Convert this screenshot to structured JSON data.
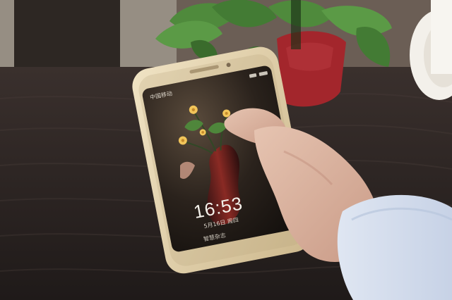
{
  "phone": {
    "lock_screen": {
      "carrier_text": "中国移动",
      "time": "16:53",
      "date": "5月16日 周四",
      "bottom_text": "智慧杂志"
    }
  },
  "colors": {
    "table_wood": "#2b2422",
    "phone_gold": "#e6d6b4",
    "screen_bg": "#1a1512",
    "flower_yellow": "#f2c55a",
    "leaf_green": "#4f8a3c",
    "pot_red": "#a3262c",
    "sleeve": "#dfe6f2",
    "skin": "#d8b3a0"
  }
}
